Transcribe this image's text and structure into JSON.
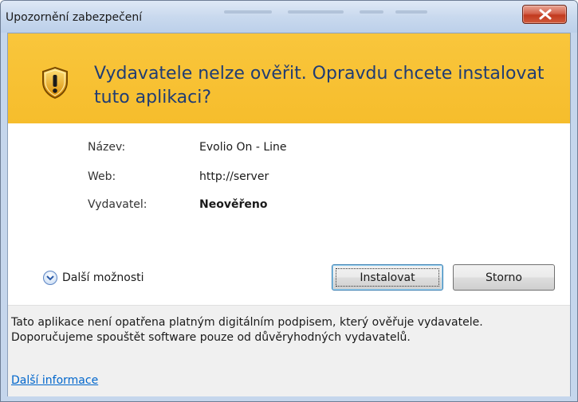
{
  "window": {
    "title": "Upozornění zabezpečení",
    "close_icon": "close-icon"
  },
  "banner": {
    "icon": "warning-shield-icon",
    "message": "Vydavatele nelze ověřit. Opravdu chcete instalovat tuto aplikaci?"
  },
  "details": {
    "name_label": "Název:",
    "name_value": "Evolio On - Line",
    "web_label": "Web:",
    "web_value": "http://server",
    "publisher_label": "Vydavatel:",
    "publisher_value": "Neověřeno"
  },
  "actions": {
    "more_options_icon": "chevron-down-circle-icon",
    "more_options_label": "Další možnosti",
    "install_label": "Instalovat",
    "cancel_label": "Storno"
  },
  "footer": {
    "text": "Tato aplikace není opatřena platným digitálním podpisem, který ověřuje vydavatele. Doporučujeme spouštět software pouze od důvěryhodných vydavatelů.",
    "link_label": "Další informace"
  },
  "colors": {
    "banner": "#f7c235",
    "banner_text": "#1f3c74",
    "link": "#0066cc"
  }
}
